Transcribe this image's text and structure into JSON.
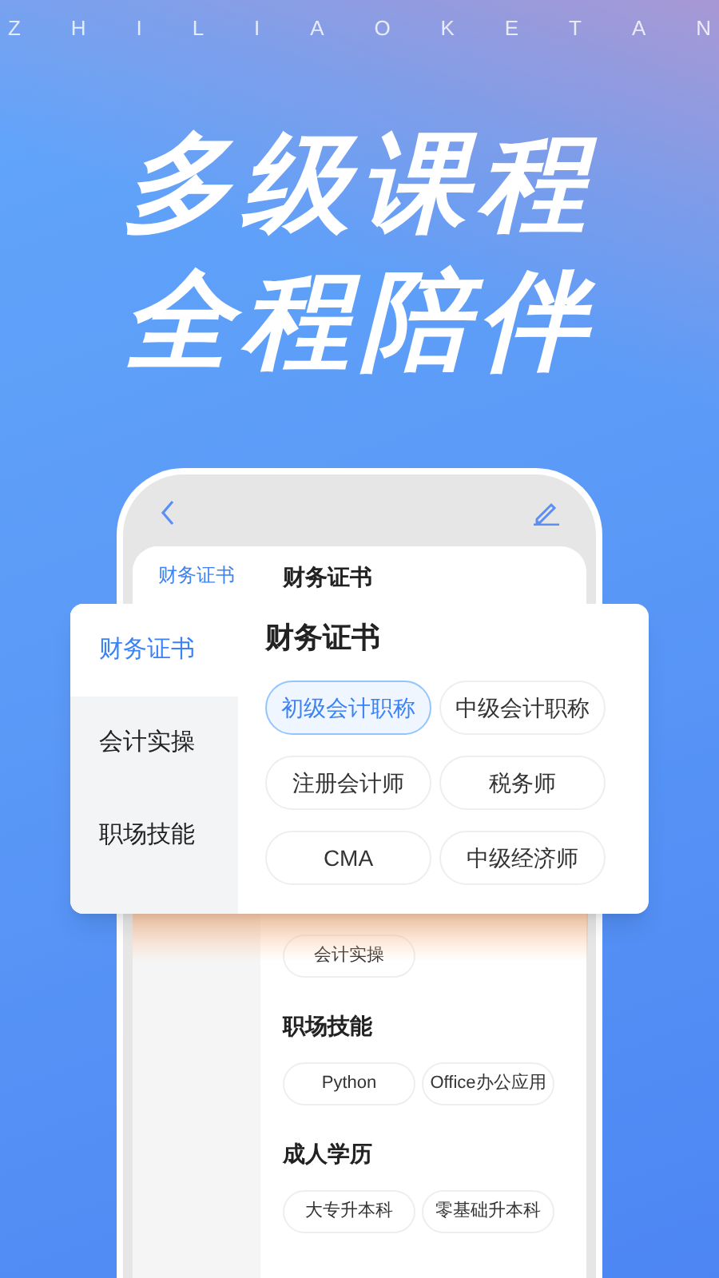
{
  "brand_letters": [
    "Z",
    "H",
    "I",
    "L",
    "I",
    "A",
    "O",
    "K",
    "E",
    "T",
    "A",
    "N"
  ],
  "headline": [
    "多级课程",
    "全程陪伴"
  ],
  "phone": {
    "sidebar": [
      {
        "label": "财务证书",
        "selected": true
      }
    ],
    "title": "财务证书",
    "sections": [
      {
        "chips": [
          "会计实操"
        ]
      },
      {
        "title": "职场技能",
        "chips": [
          "Python",
          "Office办公应用"
        ]
      },
      {
        "title": "成人学历",
        "chips": [
          "大专升本科",
          "零基础升本科"
        ]
      }
    ]
  },
  "overlay": {
    "categories": [
      {
        "label": "财务证书",
        "selected": true
      },
      {
        "label": "会计实操",
        "selected": false
      },
      {
        "label": "职场技能",
        "selected": false
      }
    ],
    "title": "财务证书",
    "chips": [
      {
        "label": "初级会计职称",
        "selected": true
      },
      {
        "label": "中级会计职称",
        "selected": false
      },
      {
        "label": "注册会计师",
        "selected": false
      },
      {
        "label": "税务师",
        "selected": false
      },
      {
        "label": "CMA",
        "selected": false
      },
      {
        "label": "中级经济师",
        "selected": false
      }
    ]
  }
}
